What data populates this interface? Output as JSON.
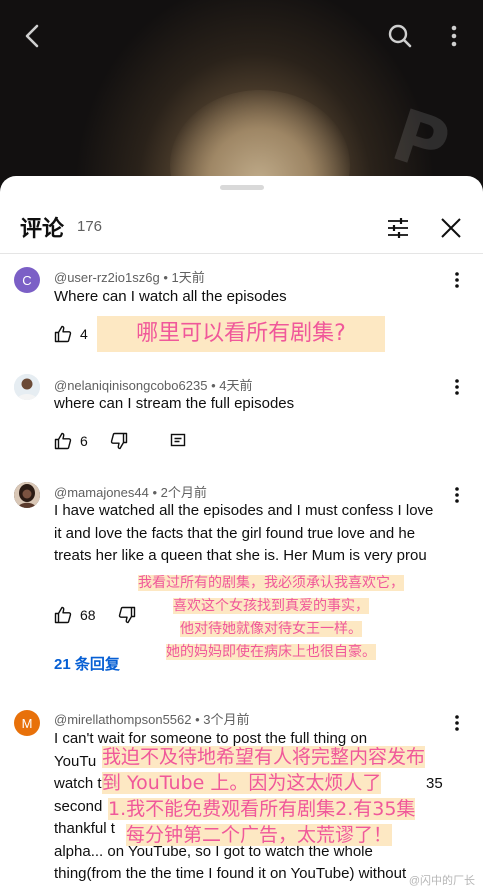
{
  "header": {
    "title": "评论",
    "count": "176"
  },
  "icons": {
    "back": "back-arrow-icon",
    "search": "search-icon",
    "more": "more-vert-icon",
    "sort": "sort-sliders-icon",
    "close": "close-icon",
    "like": "thumb-up-icon",
    "dislike": "thumb-down-icon",
    "reply": "reply-icon"
  },
  "colors": {
    "accent": "#065fd4",
    "overlay_text": "#f0589a",
    "overlay_bg": "#fde6be"
  },
  "comments": [
    {
      "avatar_letter": "C",
      "avatar_color": "#7b5fc6",
      "author": "@user-rz2io1sz6g",
      "time": "1天前",
      "text": "Where can I watch all the episodes",
      "likes": "4"
    },
    {
      "author": "@nelaniqinisongcobo6235",
      "time": "4天前",
      "text": "where can I stream the full episodes",
      "likes": "6"
    },
    {
      "author": "@mamajones44",
      "time": "2个月前",
      "text": "I have watched all the episodes and I must confess I love it and love the facts that the girl found true love and he treats her like a queen that she is. Her Mum is very prou",
      "likes": "68",
      "replies": "21 条回复"
    },
    {
      "avatar_letter": "M",
      "avatar_color": "#e8710a",
      "author": "@mirellathompson5562",
      "time": "3个月前",
      "line1": "I can't wait for someone to post the full thing on",
      "line2": "YouTu",
      "line3a": "watch the",
      "line3b": "35",
      "line4": "second",
      "line5": "thankful t",
      "line6": "alpha... on YouTube, so I got to watch the whole",
      "line7": "thing(from the the time I found it on YouTube) without"
    }
  ],
  "overlays": {
    "c1": "哪里可以看所有剧集?",
    "c3": [
      "我看过所有的剧集，我必须承认我喜欢它，",
      "喜欢这个女孩找到真爱的事实，",
      "他对待她就像对待女王一样。",
      "她的妈妈即使在病床上也很自豪。"
    ],
    "c4": [
      "我迫不及待地希望有人将完整内容发布",
      "到 YouTube 上。因为这太烦人了",
      "1.我不能免费观看所有剧集2.有35集",
      "每分钟第二个广告，太荒谬了！"
    ]
  },
  "watermark": "@闪中的厂长"
}
